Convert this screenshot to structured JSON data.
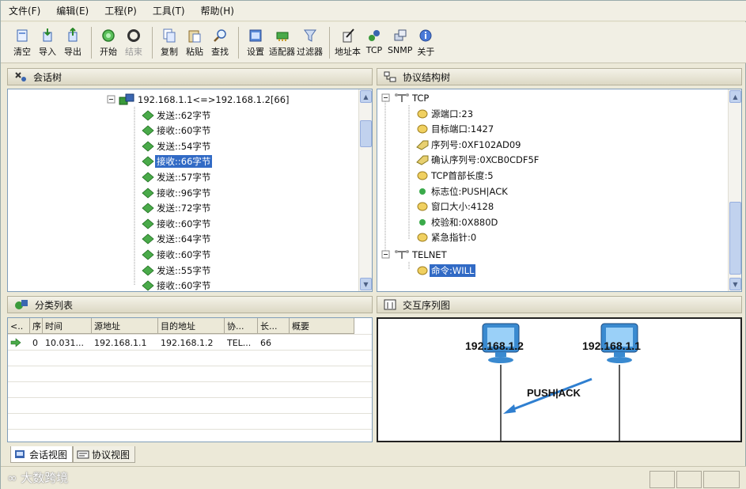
{
  "menu": [
    "文件(F)",
    "编辑(E)",
    "工程(P)",
    "工具(T)",
    "帮助(H)"
  ],
  "toolbar": [
    {
      "label": "清空",
      "icon": "clear-icon",
      "disabled": false
    },
    {
      "label": "导入",
      "icon": "import-icon",
      "disabled": false
    },
    {
      "label": "导出",
      "icon": "export-icon",
      "disabled": false
    },
    {
      "label": "开始",
      "icon": "start-icon",
      "disabled": false
    },
    {
      "label": "结束",
      "icon": "stop-icon",
      "disabled": true
    },
    {
      "label": "复制",
      "icon": "copy-icon",
      "disabled": false
    },
    {
      "label": "粘贴",
      "icon": "paste-icon",
      "disabled": false
    },
    {
      "label": "查找",
      "icon": "find-icon",
      "disabled": false
    },
    {
      "label": "设置",
      "icon": "settings-icon",
      "disabled": false
    },
    {
      "label": "适配器",
      "icon": "adapter-icon",
      "disabled": false
    },
    {
      "label": "过滤器",
      "icon": "filter-icon",
      "disabled": false
    },
    {
      "label": "地址本",
      "icon": "address-book-icon",
      "disabled": false
    },
    {
      "label": "TCP",
      "icon": "tcp-icon",
      "disabled": false
    },
    {
      "label": "SNMP",
      "icon": "snmp-icon",
      "disabled": false
    },
    {
      "label": "关于",
      "icon": "about-icon",
      "disabled": false
    }
  ],
  "session_tree": {
    "title": "会话树",
    "root": "192.168.1.1<=>192.168.1.2[66]",
    "items": [
      {
        "label": "发送::62字节",
        "selected": false
      },
      {
        "label": "接收::60字节",
        "selected": false
      },
      {
        "label": "发送::54字节",
        "selected": false
      },
      {
        "label": "接收::66字节",
        "selected": true
      },
      {
        "label": "发送::57字节",
        "selected": false
      },
      {
        "label": "接收::96字节",
        "selected": false
      },
      {
        "label": "发送::72字节",
        "selected": false
      },
      {
        "label": "接收::60字节",
        "selected": false
      },
      {
        "label": "发送::64字节",
        "selected": false
      },
      {
        "label": "接收::60字节",
        "selected": false
      },
      {
        "label": "发送::55字节",
        "selected": false
      },
      {
        "label": "接收::60字节",
        "selected": false
      }
    ]
  },
  "protocol_tree": {
    "title": "协议结构树",
    "tcp_label": "TCP",
    "tcp_fields": [
      {
        "label": "源端口:23",
        "icon": "field-dot-icon"
      },
      {
        "label": "目标端口:1427",
        "icon": "field-dot-icon"
      },
      {
        "label": "序列号:0XF102AD09",
        "icon": "field-tag-icon"
      },
      {
        "label": "确认序列号:0XCB0CDF5F",
        "icon": "field-tag-icon"
      },
      {
        "label": "TCP首部长度:5",
        "icon": "field-dot-icon"
      },
      {
        "label": "标志位:PUSH|ACK",
        "icon": "flag-dot-icon"
      },
      {
        "label": "窗口大小:4128",
        "icon": "field-dot-icon"
      },
      {
        "label": "校验和:0X880D",
        "icon": "flag-dot-icon"
      },
      {
        "label": "紧急指针:0",
        "icon": "field-dot-icon"
      }
    ],
    "telnet_label": "TELNET",
    "telnet_fields": [
      {
        "label": "命令:WILL",
        "selected": true
      }
    ]
  },
  "class_list": {
    "title": "分类列表",
    "columns": [
      "<..",
      "序",
      "时间",
      "源地址",
      "目的地址",
      "协...",
      "长...",
      "概要"
    ],
    "rows": [
      [
        "",
        "0",
        "10.031...",
        "192.168.1.1",
        "192.168.1.2",
        "TEL...",
        "66",
        ""
      ]
    ]
  },
  "sequence": {
    "title": "交互序列图",
    "left_host": "192.168.1.2",
    "right_host": "192.168.1.1",
    "message": "PUSH|ACK"
  },
  "tabs": [
    {
      "label": "会话视图",
      "active": true
    },
    {
      "label": "协议视图",
      "active": false
    }
  ],
  "watermark": "大数跨境",
  "colors": {
    "selection": "#316ac5",
    "pane_border": "#7f9db9",
    "arrow": "#2f7fd0"
  }
}
